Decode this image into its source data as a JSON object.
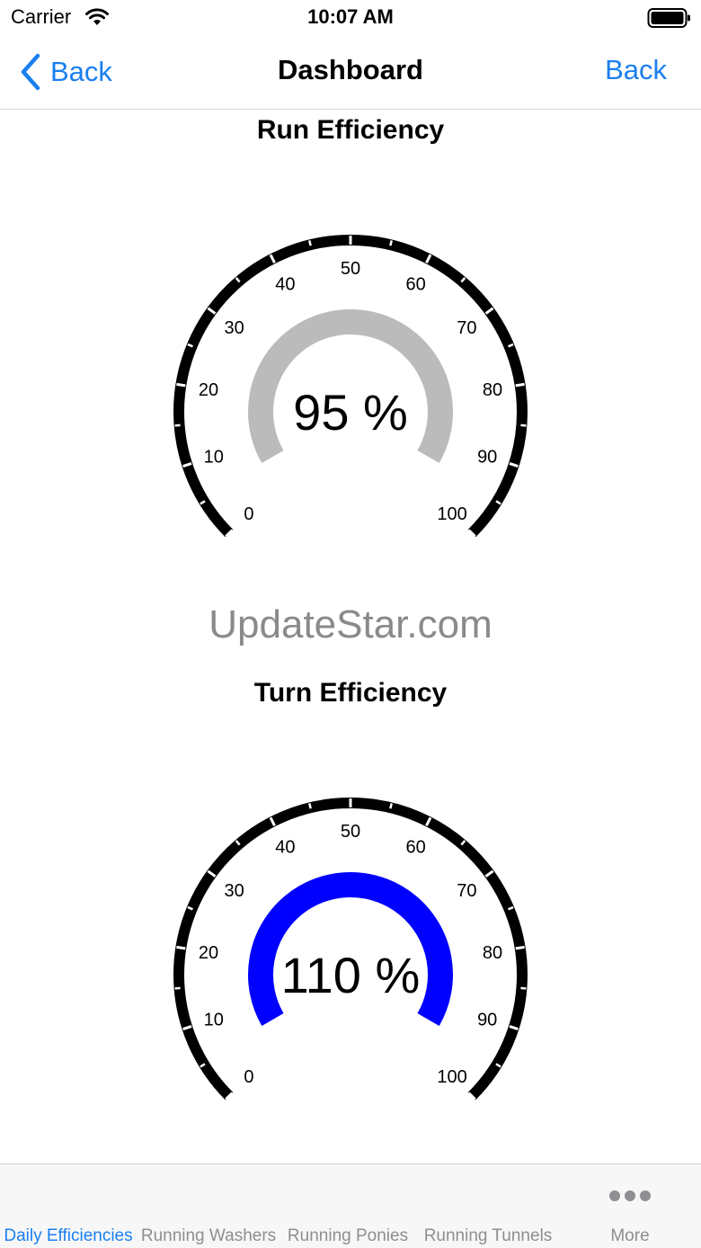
{
  "status_bar": {
    "carrier": "Carrier",
    "time": "10:07 AM"
  },
  "nav": {
    "back_left_label": "Back",
    "title": "Dashboard",
    "back_right_label": "Back",
    "accent_color": "#1a7ff0"
  },
  "gauges": [
    {
      "title": "Run Efficiency",
      "value_label": "95 %",
      "fill_color": "#bbbbbb",
      "ticks": [
        "0",
        "10",
        "20",
        "30",
        "40",
        "50",
        "60",
        "70",
        "80",
        "90",
        "100"
      ]
    },
    {
      "title": "Turn Efficiency",
      "value_label": "110 %",
      "fill_color": "#0000ff",
      "ticks": [
        "0",
        "10",
        "20",
        "30",
        "40",
        "50",
        "60",
        "70",
        "80",
        "90",
        "100"
      ]
    }
  ],
  "watermark": "UpdateStar.com",
  "tabs": [
    {
      "label": "Daily Efficiencies",
      "active": true
    },
    {
      "label": "Running Washers",
      "active": false
    },
    {
      "label": "Running Ponies",
      "active": false
    },
    {
      "label": "Running Tunnels",
      "active": false
    },
    {
      "label": "More",
      "active": false,
      "icon": "more-dots-icon"
    }
  ]
}
